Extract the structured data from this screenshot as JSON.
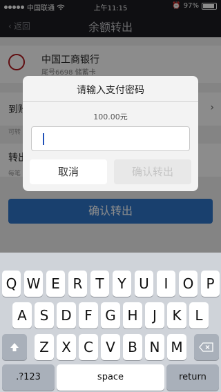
{
  "status_bar": {
    "carrier": "中国联通",
    "time": "上午11:15",
    "battery_percent": "97%",
    "battery_level": 0.97,
    "icons": [
      "signal-dots-icon",
      "wifi-icon",
      "alarm-icon",
      "battery-icon"
    ]
  },
  "nav": {
    "back_label": "返回",
    "title": "余额转出"
  },
  "bank": {
    "name": "中国工商银行",
    "account": "尾号6698 储蓄卡"
  },
  "rows": {
    "arrival_label": "到账",
    "arrival_hint": "可转",
    "amount_label": "转出",
    "amount_hint": "每笔"
  },
  "confirm_bg_label": "确认转出",
  "dialog": {
    "title": "请输入支付密码",
    "amount": "100.00元",
    "cancel_label": "取消",
    "confirm_label": "确认转出"
  },
  "keyboard": {
    "row1": [
      "Q",
      "W",
      "E",
      "R",
      "T",
      "Y",
      "U",
      "I",
      "O",
      "P"
    ],
    "row2": [
      "A",
      "S",
      "D",
      "F",
      "G",
      "H",
      "J",
      "K",
      "L"
    ],
    "row3": [
      "Z",
      "X",
      "C",
      "V",
      "B",
      "N",
      "M"
    ],
    "numbers_label": ".?123",
    "space_label": "space",
    "return_label": "return"
  },
  "colors": {
    "nav_bg": "#1c1d22",
    "primary_button": "#2f76c8",
    "keyboard_bg": "#cfd3d9"
  }
}
